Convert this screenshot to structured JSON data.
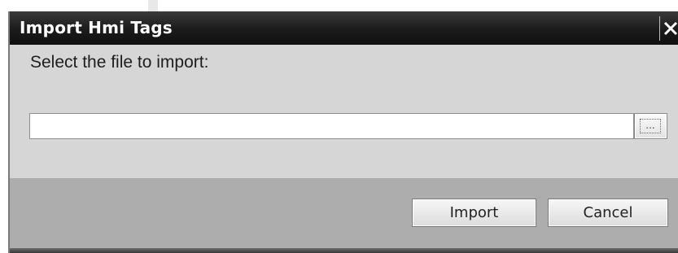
{
  "dialog": {
    "title": "Import Hmi Tags",
    "close_icon": "close-icon",
    "prompt": "Select the file to import:",
    "file_path": "",
    "browse_label": "...",
    "import_label": "Import",
    "cancel_label": "Cancel"
  }
}
